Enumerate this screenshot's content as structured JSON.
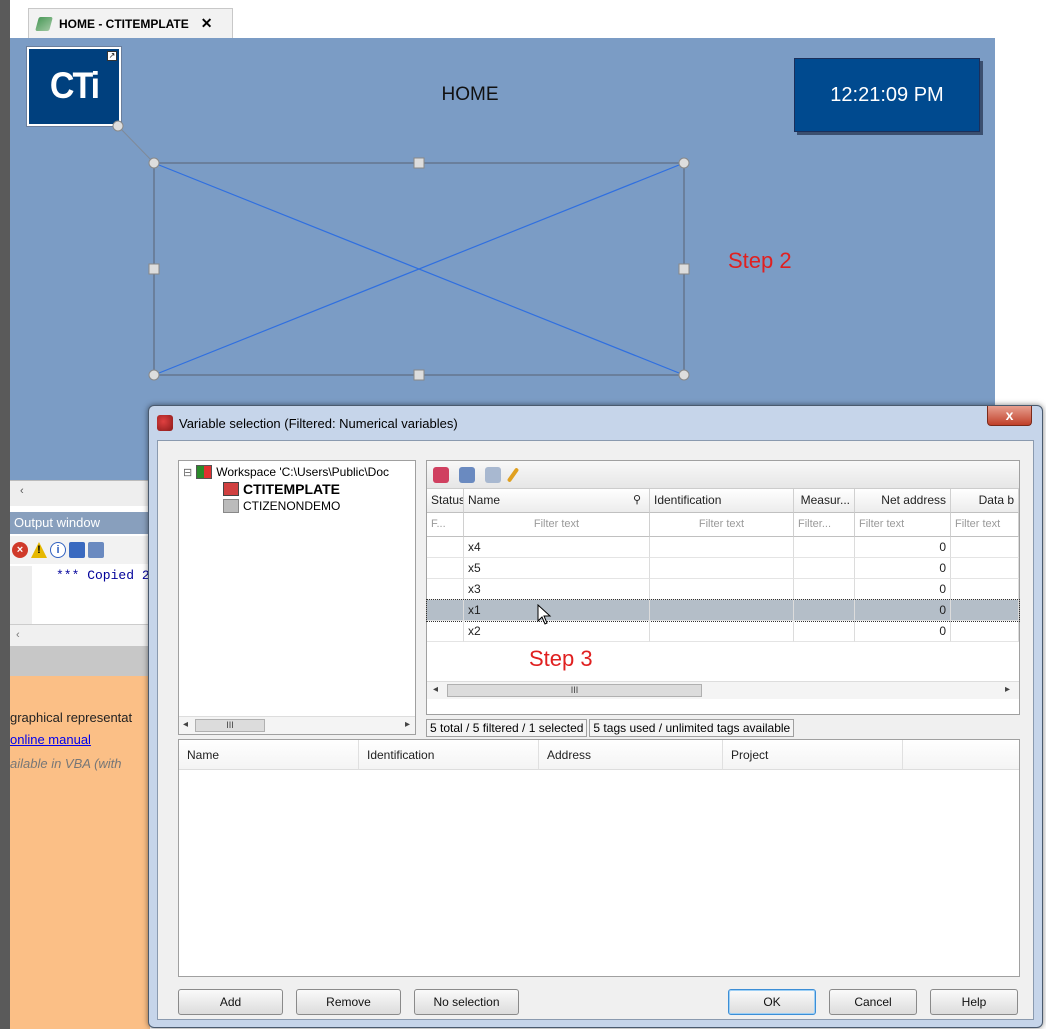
{
  "tab": {
    "title": "HOME - CTITEMPLATE",
    "close": "✕"
  },
  "canvas": {
    "logo_text": "CTi",
    "logo_badge": "↗",
    "title": "HOME",
    "clock": "12:21:09 PM",
    "annotation": "Step 2"
  },
  "output": {
    "scroll_arrow": "‹",
    "header": "Output window",
    "text": "*** Copied 2",
    "bottom_arrow": "‹",
    "info_line": "graphical representat",
    "link": "online manual",
    "note": "ailable in VBA (with"
  },
  "dialog": {
    "title": "Variable selection (Filtered: Numerical variables)",
    "close": "x",
    "tree": {
      "workspace": "Workspace 'C:\\Users\\Public\\Doc",
      "project1": "CTITEMPLATE",
      "project2": "CTIZENONDEMO",
      "expander": "⊟",
      "hs_left": "◂",
      "hs_thumb": "III",
      "hs_right": "▸"
    },
    "grid": {
      "headers": [
        "Status",
        "Name",
        "Identification",
        "Measur...",
        "Net address",
        "Data b"
      ],
      "filters": [
        "F...",
        "Filter text",
        "Filter text",
        "Filter...",
        "Filter text",
        "Filter text"
      ],
      "rows": [
        {
          "name": "x4",
          "net": "0"
        },
        {
          "name": "x5",
          "net": "0"
        },
        {
          "name": "x3",
          "net": "0"
        },
        {
          "name": "x1",
          "net": "0",
          "selected": true
        },
        {
          "name": "x2",
          "net": "0"
        }
      ],
      "annotation": "Step 3",
      "hs_thumb": "III",
      "hs_left": "◂",
      "hs_right": "▸"
    },
    "status": {
      "counts": "5 total / 5 filtered / 1 selected",
      "tags": "5 tags used / unlimited tags available"
    },
    "selection_headers": [
      "Name",
      "Identification",
      "Address",
      "Project"
    ],
    "buttons": {
      "add": "Add",
      "remove": "Remove",
      "no_selection": "No selection",
      "ok": "OK",
      "cancel": "Cancel",
      "help": "Help"
    }
  }
}
